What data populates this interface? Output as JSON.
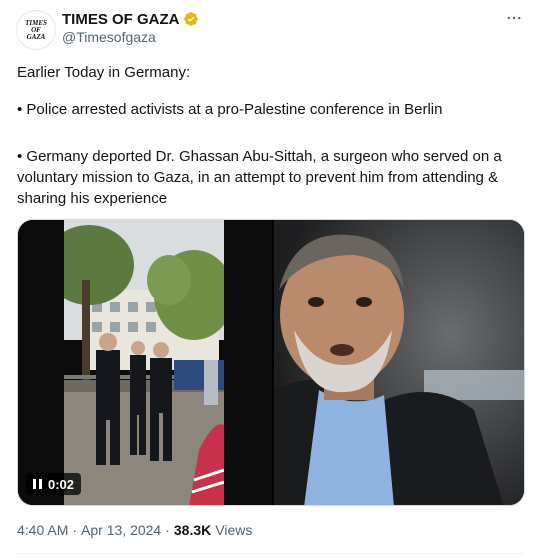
{
  "author": {
    "display_name": "TIMES OF GAZA",
    "handle": "@Timesofgaza",
    "avatar_text": [
      "TIMES",
      "OF",
      "GAZA"
    ],
    "verified_color": "#E2B719"
  },
  "tweet": {
    "intro": "Earlier Today in Germany:",
    "bullet_1": "• Police arrested activists at a pro-Palestine conference in Berlin",
    "bullet_2": "• Germany deported Dr. Ghassan Abu-Sittah, a surgeon who served on a voluntary mission to Gaza, in an attempt to prevent him from attending & sharing his experience"
  },
  "media": {
    "video_duration": "0:02",
    "left_icon": "pause-icon",
    "right_image": "portrait-photo"
  },
  "meta": {
    "time": "4:40 AM",
    "separator": "·",
    "date": "Apr 13, 2024",
    "views_count": "38.3K",
    "views_label": "Views"
  },
  "icons": {
    "more": "more-options-icon",
    "verified": "verified-badge-icon"
  },
  "colors": {
    "text_primary": "#0f1419",
    "text_secondary": "#536471",
    "border": "#cfd9de"
  }
}
